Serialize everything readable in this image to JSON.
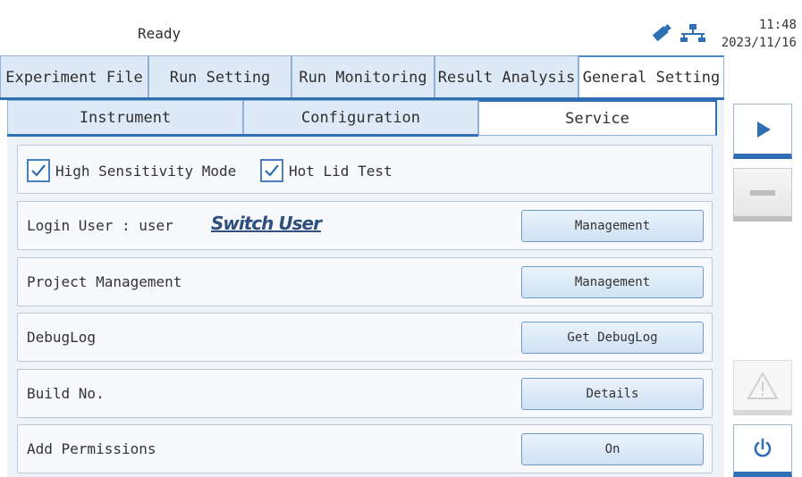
{
  "status": {
    "text": "Ready",
    "time": "11:48",
    "date": "2023/11/16",
    "icons": [
      "usb-icon",
      "network-icon"
    ]
  },
  "main_tabs": [
    {
      "label": "Experiment File"
    },
    {
      "label": "Run Setting"
    },
    {
      "label": "Run Monitoring"
    },
    {
      "label": "Result Analysis"
    },
    {
      "label": "General Setting",
      "active": true
    }
  ],
  "sub_tabs": [
    {
      "label": "Instrument"
    },
    {
      "label": "Configuration"
    },
    {
      "label": "Service",
      "active": true
    }
  ],
  "service": {
    "high_sensitivity": {
      "label": "High Sensitivity Mode",
      "checked": true
    },
    "hot_lid_test": {
      "label": "Hot Lid Test",
      "checked": true
    },
    "login": {
      "label": "Login User : user",
      "switch_label": "Switch User",
      "button": "Management"
    },
    "project": {
      "label": "Project Management",
      "button": "Management"
    },
    "debuglog": {
      "label": "DebugLog",
      "button": "Get DebugLog"
    },
    "build": {
      "label": "Build No.",
      "button": "Details"
    },
    "permissions": {
      "label": "Add Permissions",
      "button": "On"
    }
  },
  "side_controls": [
    "play-icon",
    "stop-icon",
    "warning-icon",
    "power-icon"
  ],
  "colors": {
    "accent": "#2f6fb6",
    "tab_bg": "#dde9f6",
    "panel_bg": "#eef3fa",
    "button_border": "#6f9bcf"
  }
}
